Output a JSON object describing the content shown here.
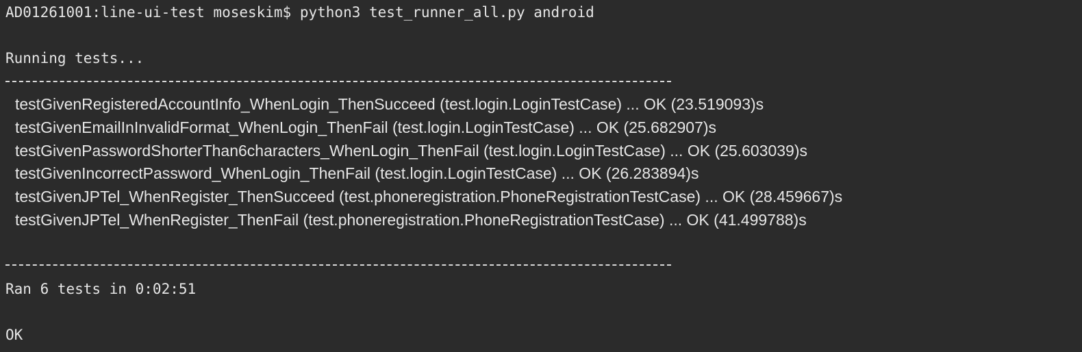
{
  "terminal": {
    "prompt": "AD01261001:line-ui-test moseskim$ python3 test_runner_all.py android",
    "running": "Running tests...",
    "results": [
      "testGivenRegisteredAccountInfo_WhenLogin_ThenSucceed (test.login.LoginTestCase) ... OK (23.519093)s",
      "testGivenEmailInInvalidFormat_WhenLogin_ThenFail (test.login.LoginTestCase) ... OK (25.682907)s",
      "testGivenPasswordShorterThan6characters_WhenLogin_ThenFail (test.login.LoginTestCase) ... OK (25.603039)s",
      "testGivenIncorrectPassword_WhenLogin_ThenFail (test.login.LoginTestCase) ... OK (26.283894)s",
      "testGivenJPTel_WhenRegister_ThenSucceed (test.phoneregistration.PhoneRegistrationTestCase) ... OK (28.459667)s",
      "testGivenJPTel_WhenRegister_ThenFail (test.phoneregistration.PhoneRegistrationTestCase) ... OK (41.499788)s"
    ],
    "summary": "Ran 6 tests in 0:02:51",
    "status": "OK"
  }
}
